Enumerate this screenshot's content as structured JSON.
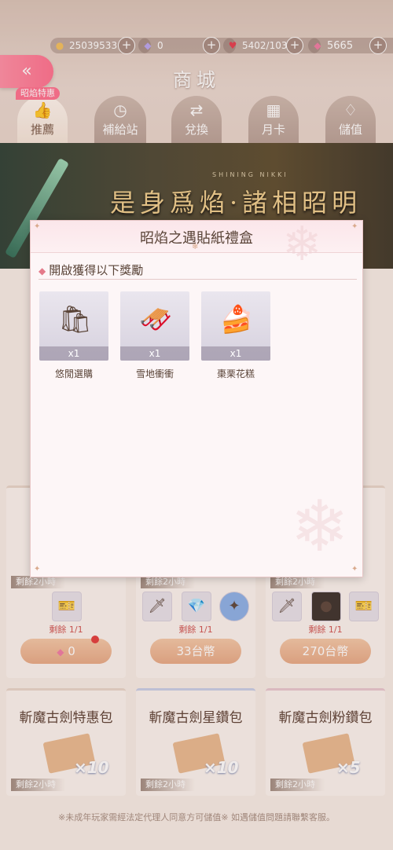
{
  "resources": {
    "gold": "25039533",
    "diamond": "0",
    "stamina": "5402/103",
    "pink_diamond": "5665"
  },
  "header": {
    "title": "商城",
    "back_icon": "«",
    "badge": "昭焰特惠"
  },
  "tabs": [
    {
      "label": "推薦",
      "icon": "thumbs-up"
    },
    {
      "label": "補給站",
      "icon": "clock"
    },
    {
      "label": "兌換",
      "icon": "exchange"
    },
    {
      "label": "月卡",
      "icon": "calendar"
    },
    {
      "label": "儲值",
      "icon": "gem"
    }
  ],
  "banner": {
    "subtitle": "SHINING   NIKKI",
    "text": "是身爲焰·諸相昭明"
  },
  "modal": {
    "title": "昭焰之遇貼紙禮盒",
    "section": "開啟獲得以下獎勵",
    "items": [
      {
        "name": "悠閒選購",
        "qty": "x1",
        "icon": "shopping-bag"
      },
      {
        "name": "雪地衝衝",
        "qty": "x1",
        "icon": "sled"
      },
      {
        "name": "棗栗花糕",
        "qty": "x1",
        "icon": "cake"
      }
    ]
  },
  "cards_row1": [
    {
      "timer": "剩餘2小時",
      "remain": "剩餘 1/1",
      "price": "0"
    },
    {
      "timer": "剩餘2小時",
      "remain": "剩餘 1/1",
      "price": "33台幣"
    },
    {
      "timer": "剩餘2小時",
      "remain": "剩餘 1/1",
      "price": "270台幣"
    }
  ],
  "cards_row2": [
    {
      "title": "斬魔古劍特惠包",
      "mult": "×10",
      "timer": "剩餘2小時"
    },
    {
      "title": "斬魔古劍星鑽包",
      "mult": "×10",
      "timer": "剩餘2小時"
    },
    {
      "title": "斬魔古劍粉鑽包",
      "mult": "×5",
      "timer": "剩餘2小時"
    }
  ],
  "footer": "※未成年玩家需經法定代理人同意方可儲值※ 如遇儲值問題請聯繫客服。",
  "colors": {
    "accent_pink": "#ff6f8e",
    "price_button": "#e7a985",
    "banner_gold": "#f0cf8d"
  }
}
